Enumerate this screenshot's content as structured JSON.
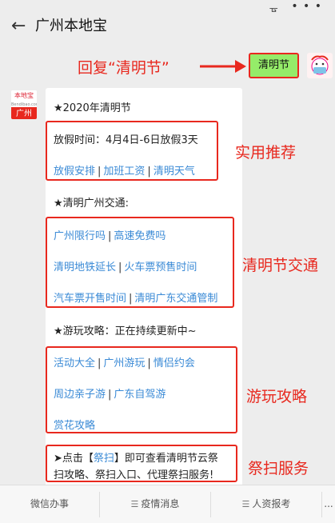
{
  "status": {
    "icon": "ᚗ",
    "menu": "• • •"
  },
  "header": {
    "back_icon": "←",
    "title": "广州本地宝"
  },
  "annotations": {
    "reply": "回复“清明节”",
    "practical": "实用推荐",
    "traffic": "清明节交通",
    "travel": "游玩攻略",
    "tomb": "祭扫服务"
  },
  "user_message": "清明节",
  "bot": {
    "avatar_top": "本地宝",
    "avatar_sub": "Bendibao.com",
    "avatar_city": "广州"
  },
  "message": {
    "heading": "★2020年清明节",
    "holiday": "放假时间：4月4日-6日放假3天",
    "practical_links": [
      "放假安排",
      "加班工资",
      "清明天气"
    ],
    "traffic_heading": "★清明广州交通:",
    "traffic_rows": [
      [
        "广州限行吗",
        "高速免费吗"
      ],
      [
        "清明地铁延长",
        "火车票预售时间"
      ],
      [
        "汽车票开售时间",
        "清明广东交通管制"
      ]
    ],
    "travel_heading": "★游玩攻略：正在持续更新中~",
    "travel_rows": [
      [
        "活动大全",
        "广州游玩",
        "情侣约会"
      ],
      [
        "周边亲子游",
        "广东自驾游"
      ],
      [
        "赏花攻略"
      ]
    ],
    "tomb_prefix": "➤点击【",
    "tomb_keyword": "祭扫",
    "tomb_suffix": "】即可查看清明节云祭",
    "tomb_line2": "扫攻略、祭扫入口、代理祭扫服务!"
  },
  "bottom_tabs": [
    "微信办事",
    "疫情消息",
    "人资报考",
    "..."
  ]
}
